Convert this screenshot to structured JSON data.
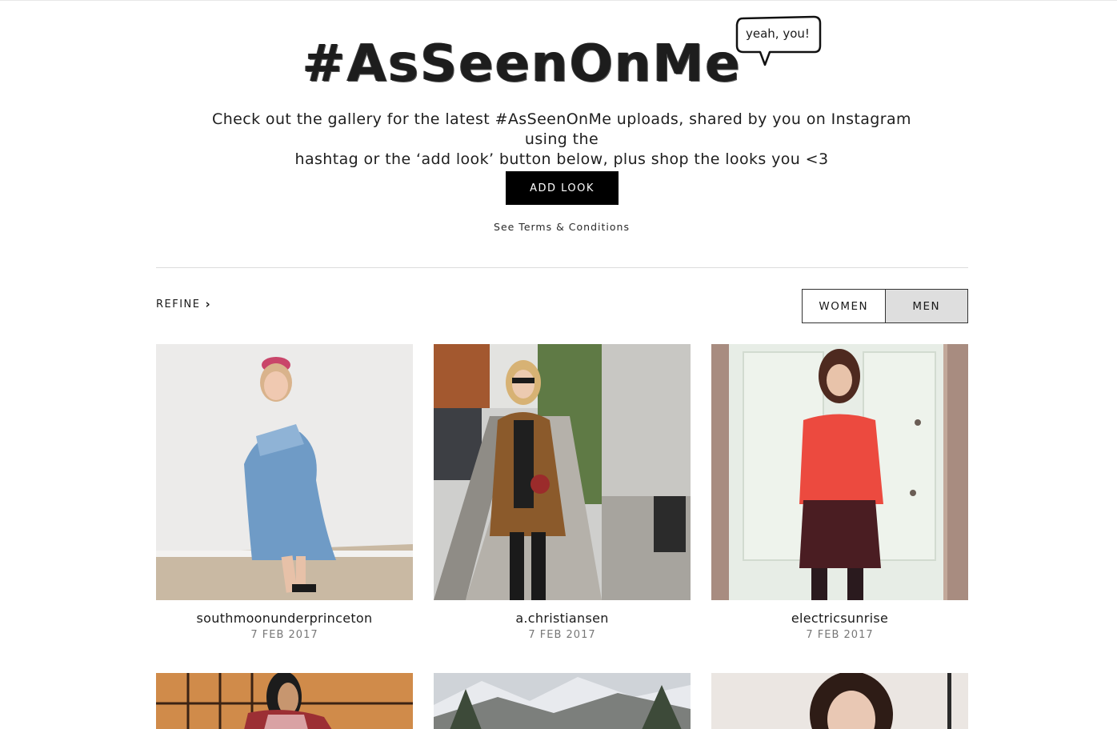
{
  "header": {
    "logo_text": "#AsSeenOnMe",
    "bubble_text": "yeah, you!",
    "intro_line1": "Check out the gallery for the latest #AsSeenOnMe uploads, shared by you on Instagram using the",
    "intro_line2": "hashtag or the ‘add look’ button below, plus shop the looks you <3",
    "add_look_label": "ADD LOOK",
    "terms_label": "See Terms & Conditions"
  },
  "filters": {
    "refine_label": "REFINE",
    "refine_icon": "chevron-right-icon",
    "tabs": [
      {
        "label": "WOMEN",
        "selected": false
      },
      {
        "label": "MEN",
        "selected": true
      }
    ]
  },
  "gallery": {
    "items": [
      {
        "username": "southmoonunderprinceton",
        "date": "7 FEB 2017"
      },
      {
        "username": "a.christiansen",
        "date": "7 FEB 2017"
      },
      {
        "username": "electricsunrise",
        "date": "7 FEB 2017"
      },
      {
        "username": "",
        "date": ""
      },
      {
        "username": "",
        "date": ""
      },
      {
        "username": "",
        "date": ""
      }
    ]
  },
  "colors": {
    "button_bg": "#000000",
    "button_text": "#ffffff",
    "selected_tab_bg": "#dedede",
    "date_text": "#777777"
  }
}
